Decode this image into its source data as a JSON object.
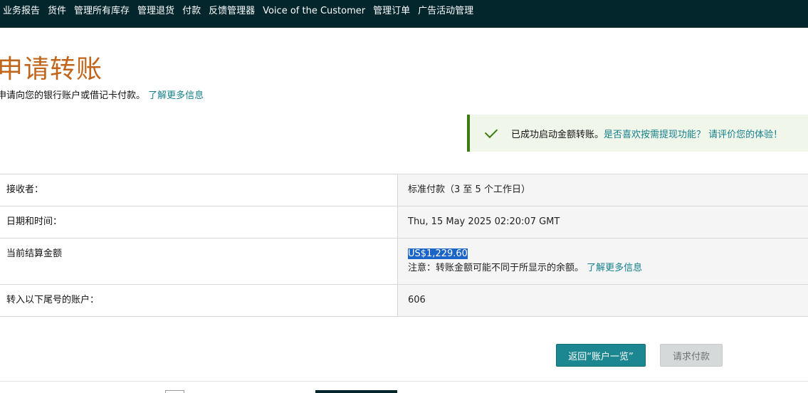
{
  "nav": {
    "items": [
      "业务报告",
      "货件",
      "管理所有库存",
      "管理退货",
      "付款",
      "反馈管理器",
      "Voice of the Customer",
      "管理订单",
      "广告活动管理"
    ]
  },
  "page": {
    "title": "申请转账",
    "subtitle": "申请向您的银行账户或借记卡付款。",
    "learn_more": "了解更多信息"
  },
  "alert": {
    "message": "已成功启动金额转账。",
    "link": "是否喜欢按需提现功能？ 请评价您的体验！",
    "accent": "#3c7d10"
  },
  "details": {
    "recipient_label": "接收者：",
    "recipient_value": "标准付款（3 至 5 个工作日）",
    "datetime_label": "日期和时间：",
    "datetime_value": "Thu, 15 May 2025 02:20:07 GMT",
    "balance_label": "当前结算金额",
    "balance_value": "US$1,229.60",
    "balance_note": "注意：转账金额可能不同于所显示的余额。",
    "balance_note_link": "了解更多信息",
    "account_label": "转入以下尾号的账户：",
    "account_value": "606"
  },
  "buttons": {
    "back": "返回“账户一览”",
    "request": "请求付款"
  }
}
